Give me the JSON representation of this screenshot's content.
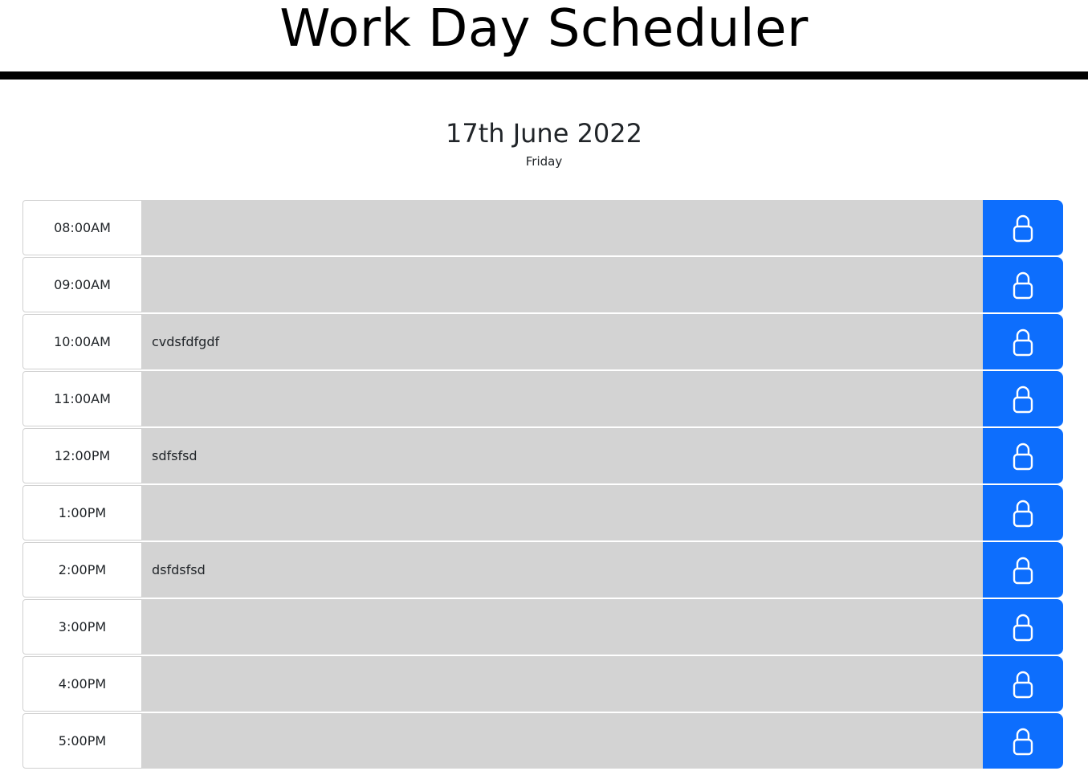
{
  "header": {
    "title": "Work Day Scheduler"
  },
  "date": {
    "full": "17th June 2022",
    "weekday": "Friday"
  },
  "colors": {
    "past": "#d3d3d3",
    "save_button": "#0d6efd",
    "header_rule": "#000000"
  },
  "save_icon": "lock-icon",
  "hours": [
    {
      "label": "08:00AM",
      "task": ""
    },
    {
      "label": "09:00AM",
      "task": ""
    },
    {
      "label": "10:00AM",
      "task": "cvdsfdfgdf"
    },
    {
      "label": "11:00AM",
      "task": ""
    },
    {
      "label": "12:00PM",
      "task": "sdfsfsd"
    },
    {
      "label": "1:00PM",
      "task": ""
    },
    {
      "label": "2:00PM",
      "task": "dsfdsfsd"
    },
    {
      "label": "3:00PM",
      "task": ""
    },
    {
      "label": "4:00PM",
      "task": ""
    },
    {
      "label": "5:00PM",
      "task": ""
    }
  ]
}
